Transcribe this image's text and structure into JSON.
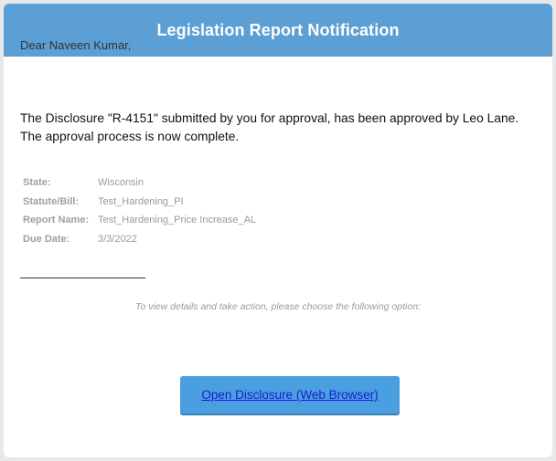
{
  "header": {
    "title": "Legislation Report Notification"
  },
  "email": {
    "greeting": "Dear Naveen Kumar,",
    "message_line1": "The Disclosure \"R-4151\" submitted by you for approval, has been approved by Leo Lane.",
    "message_line2": "The approval process is now complete."
  },
  "details": [
    {
      "label": "State:",
      "value": "Wisconsin"
    },
    {
      "label": "Statute/Bill:",
      "value": "Test_Hardening_PI"
    },
    {
      "label": "Report Name:",
      "value": "Test_Hardening_Price Increase_AL"
    },
    {
      "label": "Due Date:",
      "value": "3/3/2022"
    }
  ],
  "action": {
    "instruction": "To view details and take action, please choose the following option:",
    "button_label": "Open Disclosure (Web Browser)"
  },
  "colors": {
    "header_bg": "#5b9fd4",
    "button_bg": "#4a9fe0",
    "link": "#1a1ad6"
  }
}
